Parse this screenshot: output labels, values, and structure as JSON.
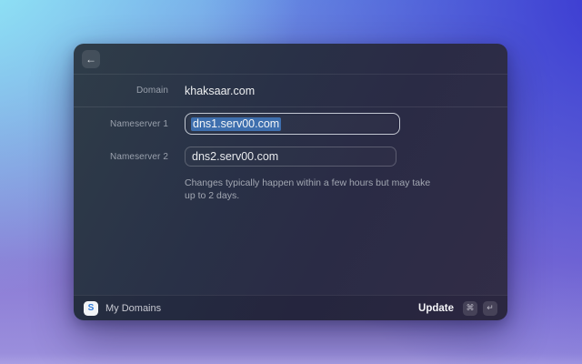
{
  "window": {
    "header": {
      "back_icon": "←"
    },
    "form": {
      "domain": {
        "label": "Domain",
        "value": "khaksaar.com"
      },
      "nameserver1": {
        "label": "Nameserver 1",
        "value": "dns1.serv00.com"
      },
      "nameserver2": {
        "label": "Nameserver 2",
        "value": "dns2.serv00.com"
      },
      "help_lines": {
        "line1": "Changes typically happen within a few hours but may take",
        "line2": "up to 2 days."
      }
    },
    "footer": {
      "app_icon_letter": "S",
      "app_name": "My Domains",
      "action_label": "Update",
      "shortcut_cmd": "⌘",
      "shortcut_enter": "↵"
    }
  },
  "colors": {
    "selection": "#3e6fae",
    "focus_ring": "#dee3eb",
    "window_top_left": "#2f3d49",
    "window_bottom": "#322d47",
    "desktop_cyan": "#93ecf7",
    "desktop_indigo": "#3a37d1",
    "desktop_purple": "#8a7ad5"
  }
}
